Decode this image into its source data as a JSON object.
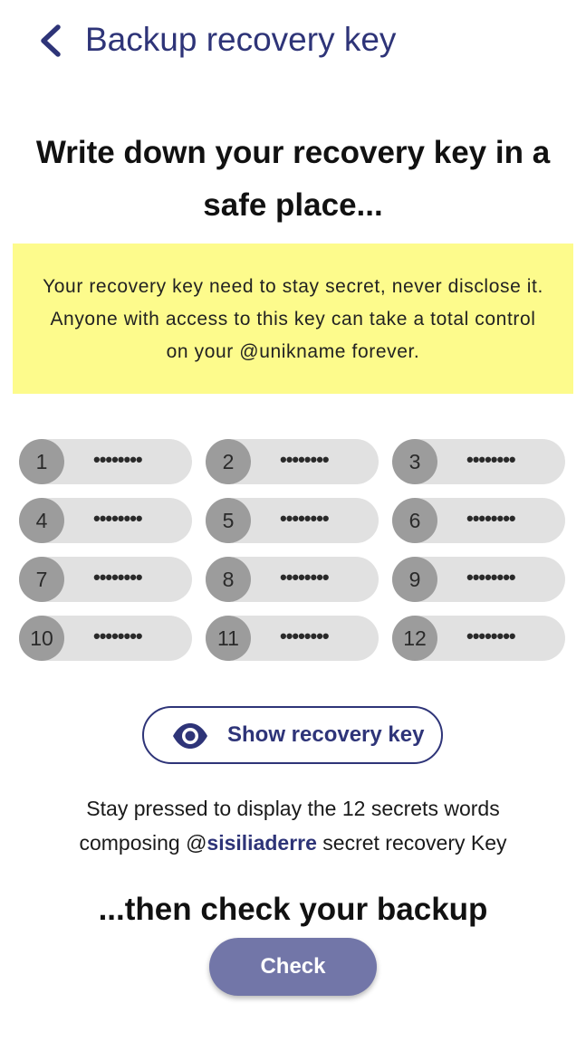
{
  "header": {
    "title": "Backup recovery key",
    "back_icon": "chevron-left-icon"
  },
  "headline": "Write down your recovery key in a safe place...",
  "warning": {
    "text": "Your recovery key need to stay secret, never disclose it. Anyone with access to this key can take a total control on your @unikname forever.",
    "background": "#fdfb8c"
  },
  "words": [
    {
      "number": "1",
      "mask": "••••••••"
    },
    {
      "number": "2",
      "mask": "••••••••"
    },
    {
      "number": "3",
      "mask": "••••••••"
    },
    {
      "number": "4",
      "mask": "••••••••"
    },
    {
      "number": "5",
      "mask": "••••••••"
    },
    {
      "number": "6",
      "mask": "••••••••"
    },
    {
      "number": "7",
      "mask": "••••••••"
    },
    {
      "number": "8",
      "mask": "••••••••"
    },
    {
      "number": "9",
      "mask": "••••••••"
    },
    {
      "number": "10",
      "mask": "••••••••"
    },
    {
      "number": "11",
      "mask": "••••••••"
    },
    {
      "number": "12",
      "mask": "••••••••"
    }
  ],
  "show_button": {
    "label": "Show recovery key",
    "icon": "eye-icon"
  },
  "instructions": {
    "line1": "Stay pressed to display the 12 secrets words",
    "prefix": "composing @",
    "username": "sisiliaderre",
    "suffix": " secret recovery Key"
  },
  "subheadline": "...then check your backup",
  "check_button": {
    "label": "Check"
  },
  "colors": {
    "accent": "#2e3478",
    "button_fill": "#7276a8",
    "pill": "#e1e1e1",
    "pill_number": "#9c9c9c"
  }
}
